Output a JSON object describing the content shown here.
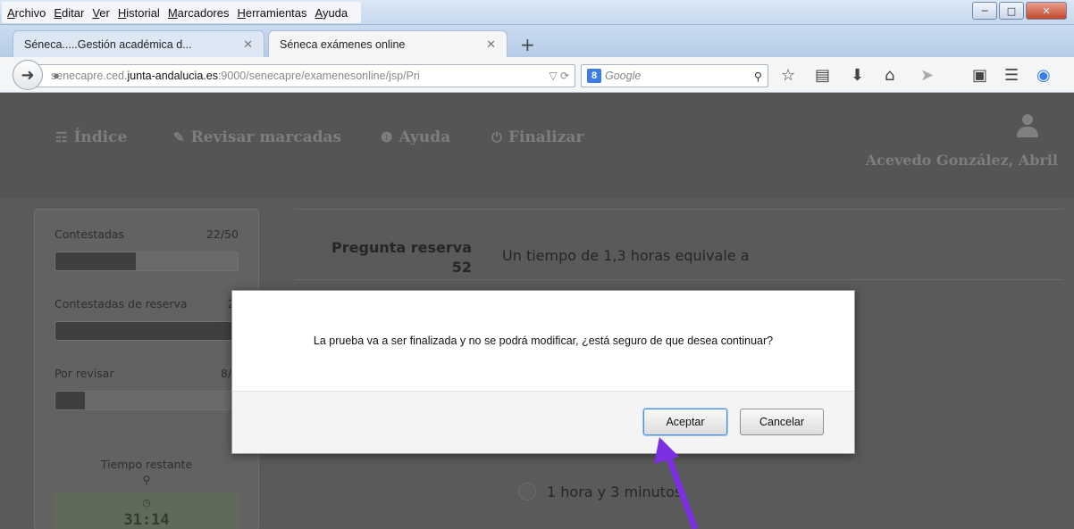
{
  "browser": {
    "menu": [
      "Archivo",
      "Editar",
      "Ver",
      "Historial",
      "Marcadores",
      "Herramientas",
      "Ayuda"
    ],
    "tabs": [
      {
        "label": "Séneca.....Gestión académica d..."
      },
      {
        "label": "Séneca exámenes online"
      }
    ],
    "url": {
      "prefix": "senecapre.ced.",
      "host": "junta-andalucia.es",
      "path": ":9000/senecapre/examenesonline/jsp/Pri"
    },
    "search_placeholder": "Google"
  },
  "nav": {
    "index": "Índice",
    "review": "Revisar marcadas",
    "help": "Ayuda",
    "finish": "Finalizar",
    "user": "Acevedo González, Abril"
  },
  "stats": {
    "answered": {
      "label": "Contestadas",
      "value": "22/50",
      "fraction": 0.44
    },
    "reserve": {
      "label": "Contestadas de reserva",
      "value": "2/",
      "fraction": 1.0
    },
    "review": {
      "label": "Por revisar",
      "value": "8/5",
      "fraction": 0.16
    },
    "time_label": "Tiempo restante",
    "time_value": "31:14"
  },
  "question": {
    "label": "Pregunta reserva",
    "number": "52",
    "text": "Un tiempo de 1,3 horas equivale a",
    "option": "1 hora y 3 minutos"
  },
  "modal": {
    "message": "La prueba va a ser finalizada y no se podrá modificar, ¿está seguro de que desea continuar?",
    "accept": "Aceptar",
    "cancel": "Cancelar"
  },
  "colors": {
    "annotation_arrow": "#7b2fe0",
    "accept_focus": "#4a90d9"
  }
}
